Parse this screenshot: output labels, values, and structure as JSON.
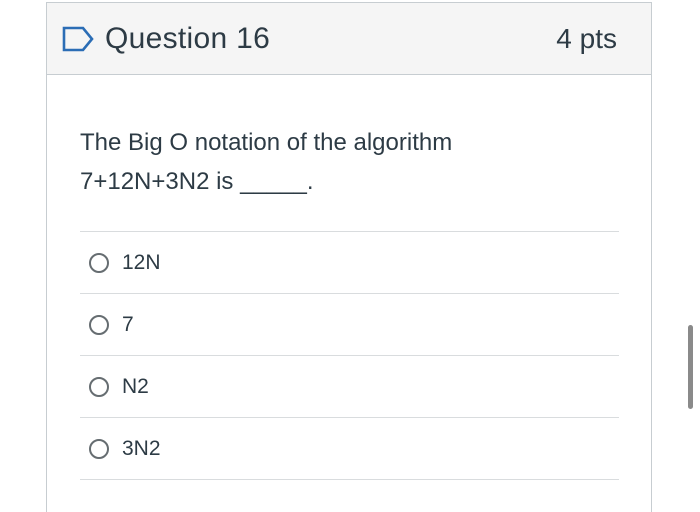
{
  "question": {
    "title": "Question 16",
    "points": "4 pts",
    "icon": "flag-outline-icon",
    "text_line1": "The Big O notation of the algorithm",
    "text_line2": "7+12N+3N2 is _____."
  },
  "answers": [
    {
      "label": "12N"
    },
    {
      "label": "7"
    },
    {
      "label": "N2"
    },
    {
      "label": "3N2"
    }
  ],
  "colors": {
    "header_bg": "#f5f5f5",
    "text": "#2d3b45",
    "flag_blue": "#2b6db5",
    "border": "#c7cdd1"
  }
}
